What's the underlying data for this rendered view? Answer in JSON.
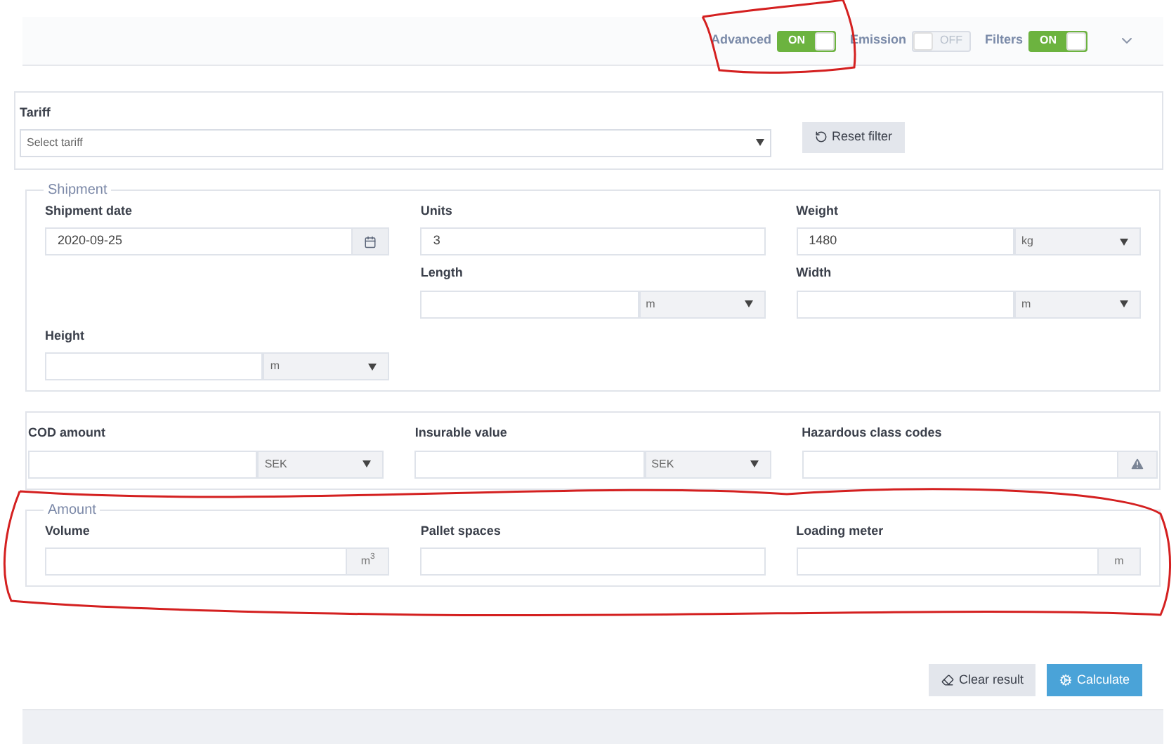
{
  "header": {
    "toggles": [
      {
        "label": "Advanced",
        "on": true,
        "text": "ON"
      },
      {
        "label": "Emission",
        "on": false,
        "text": "OFF"
      },
      {
        "label": "Filters",
        "on": true,
        "text": "ON"
      }
    ]
  },
  "tariff": {
    "label": "Tariff",
    "placeholder": "Select tariff",
    "reset_button": "Reset filter"
  },
  "shipment": {
    "legend": "Shipment",
    "rows": [
      [
        {
          "kind": "date",
          "label": "Shipment date",
          "value": "2020-09-25"
        },
        {
          "kind": "text",
          "label": "Units",
          "value": "3"
        },
        {
          "kind": "unit_select",
          "label": "Weight",
          "value": "1480",
          "unit": "kg"
        }
      ],
      [
        {
          "kind": "empty"
        },
        {
          "kind": "unit_select",
          "label": "Length",
          "unit": "m"
        },
        {
          "kind": "unit_select",
          "label": "Width",
          "unit": "m"
        }
      ],
      [
        {
          "kind": "unit_select",
          "label": "Height",
          "unit": "m"
        }
      ]
    ]
  },
  "values": {
    "fields": [
      {
        "kind": "unit_select",
        "label": "COD amount",
        "unit": "SEK"
      },
      {
        "kind": "unit_select",
        "label": "Insurable value",
        "unit": "SEK"
      },
      {
        "kind": "warning_addon",
        "label": "Hazardous class codes"
      }
    ]
  },
  "amount": {
    "legend": "Amount",
    "fields": [
      {
        "kind": "addon",
        "label": "Volume",
        "unit": "m$^{3}$"
      },
      {
        "kind": "text",
        "label": "Pallet spaces"
      },
      {
        "kind": "addon",
        "label": "Loading meter",
        "unit": "m"
      }
    ]
  },
  "buttons": {
    "clear": "Clear result",
    "calculate": "Calculate"
  }
}
